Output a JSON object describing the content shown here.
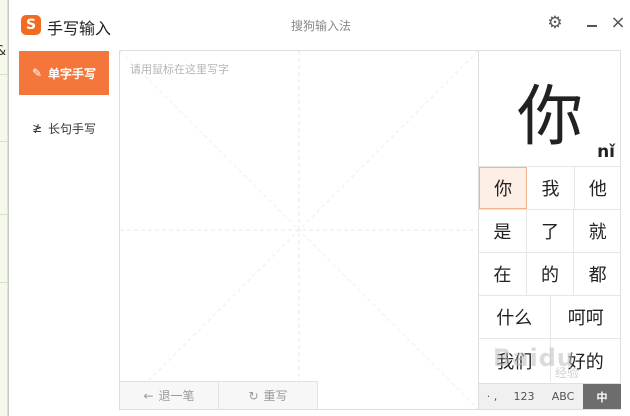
{
  "background": {
    "edge_char": "&"
  },
  "titlebar": {
    "logo_letter": "S",
    "app_title": "手写输入",
    "ime_name": "搜狗输入法",
    "settings_icon": "gear-icon",
    "minimize_icon": "minimize-icon",
    "close_glyph": "×"
  },
  "modes": [
    {
      "label": "单字手写",
      "icon": "✎",
      "active": true
    },
    {
      "label": "长句手写",
      "icon": "≱",
      "active": false
    }
  ],
  "pad": {
    "hint": "请用鼠标在这里写字",
    "undo_icon": "←",
    "undo_label": "退一笔",
    "rewrite_icon": "↻",
    "rewrite_label": "重写"
  },
  "preview": {
    "char": "你",
    "pinyin": "nǐ"
  },
  "candidates": [
    [
      "你",
      "我",
      "他"
    ],
    [
      "是",
      "了",
      "就"
    ],
    [
      "在",
      "的",
      "都"
    ],
    [
      "什么",
      "呵呵"
    ],
    [
      "我们",
      "好的"
    ]
  ],
  "ime_bar": {
    "punct": "· ,",
    "num": "123",
    "abc": "ABC",
    "zh": "中"
  },
  "watermark": {
    "text": "Baidu",
    "sub": "经验"
  },
  "colors": {
    "accent": "#f4763a",
    "selected_bg": "#fdeee6"
  }
}
